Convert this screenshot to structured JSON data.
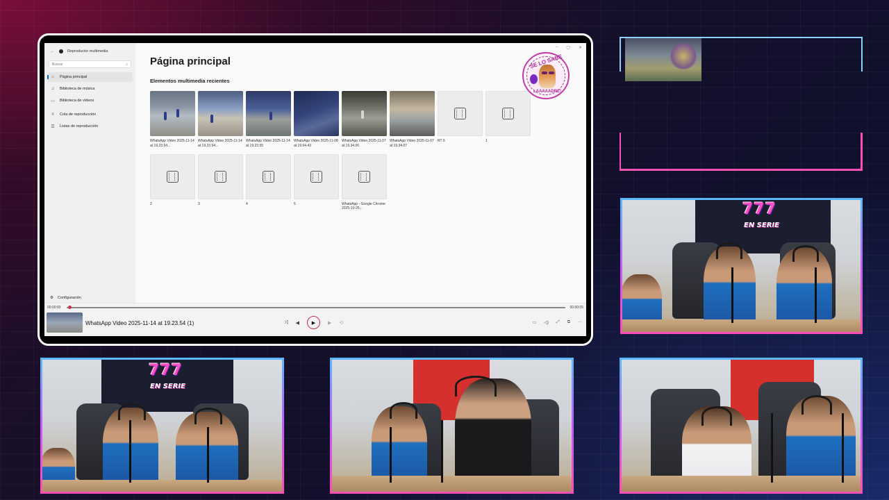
{
  "app": {
    "title": "Reproductor multimedia",
    "back_glyph": "←",
    "search_placeholder": "Buscar",
    "nav": [
      {
        "label": "Página principal",
        "icon": "⌂"
      },
      {
        "label": "Biblioteca de música",
        "icon": "♫"
      },
      {
        "label": "Biblioteca de vídeos",
        "icon": "▭"
      },
      {
        "label": "Cola de reproducción",
        "icon": "≡"
      },
      {
        "label": "Listas de reproducción",
        "icon": "☰"
      }
    ],
    "settings_label": "Configuración",
    "window_controls": [
      "–",
      "▢",
      "✕"
    ]
  },
  "main": {
    "page_title": "Página principal",
    "section_title": "Elementos multimedia recientes",
    "items": [
      {
        "caption": "WhatsApp Video 2025-11-14 at 19.23.54...",
        "kind": "video"
      },
      {
        "caption": "WhatsApp Video 2025-11-14 at 19.23.54...",
        "kind": "video"
      },
      {
        "caption": "WhatsApp Video 2025-11-14 at 19.23.55",
        "kind": "video"
      },
      {
        "caption": "WhatsApp Video 2025-11-08 at 19.04.43",
        "kind": "video"
      },
      {
        "caption": "WhatsApp Video 2025-11-07 at 19.34.06",
        "kind": "video"
      },
      {
        "caption": "WhatsApp Video 2025-11-07 at 19.34.07",
        "kind": "video"
      },
      {
        "caption": "RT 6",
        "kind": "placeholder"
      },
      {
        "caption": "1",
        "kind": "placeholder"
      },
      {
        "caption": "2",
        "kind": "placeholder"
      },
      {
        "caption": "3",
        "kind": "placeholder"
      },
      {
        "caption": "4",
        "kind": "placeholder"
      },
      {
        "caption": "5",
        "kind": "placeholder"
      },
      {
        "caption": "WhatsApp - Google Chrome 2025-10-25...",
        "kind": "placeholder"
      }
    ]
  },
  "transport": {
    "current_time": "00:00:00",
    "total_time": "00:00:05",
    "now_playing": "WhatsApp Video 2025-11-14 at 19.23.54 (1)",
    "shuffle": "⤨",
    "prev": "◀",
    "play": "▶",
    "next": "▶",
    "repeat": "⟲",
    "right_controls": [
      "▭",
      "◁)",
      "⤢",
      "⧉",
      "···"
    ]
  },
  "sticker": {
    "top_text": "SE LO SABE",
    "bottom_text": "LAAAAADRE!"
  },
  "overlay": {
    "logo_number": "777",
    "logo_sub": "EN SERIE"
  },
  "colors": {
    "accent": "#c4314b",
    "frame_blue": "#5ab8ff",
    "frame_pink": "#ff4fb5"
  }
}
